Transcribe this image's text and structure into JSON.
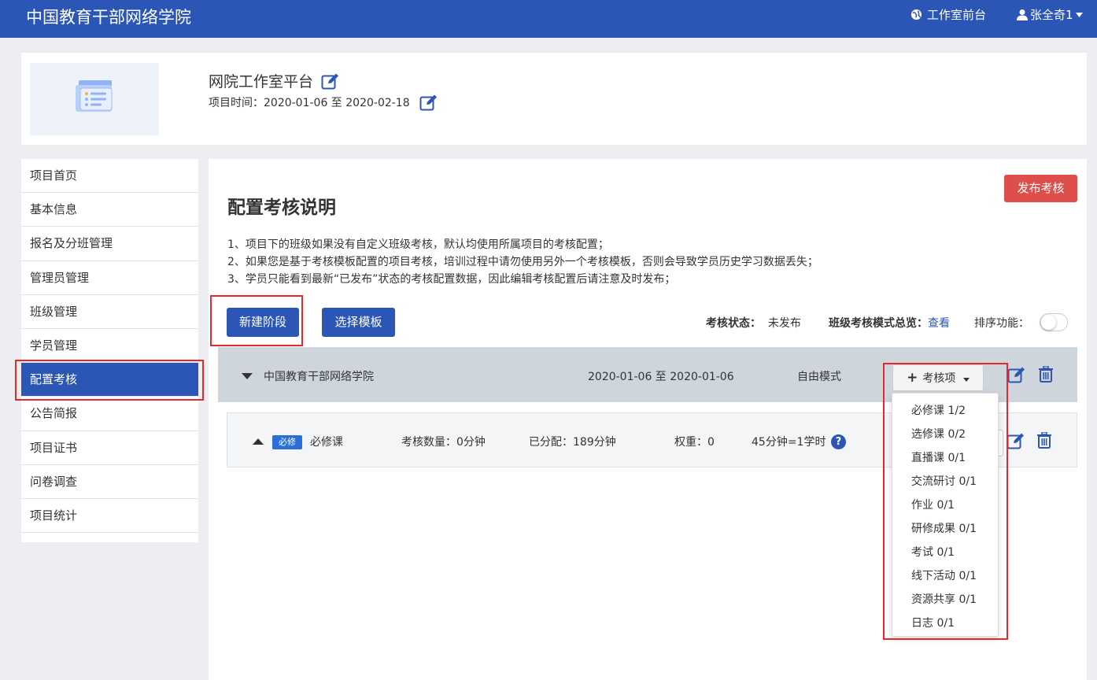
{
  "header": {
    "brand": "中国教育干部网络学院",
    "studio_link": "工作室前台",
    "user_name": "张全奇1"
  },
  "project": {
    "title": "网院工作室平台",
    "time_label": "项目时间：",
    "time_range": "2020-01-06 至 2020-02-18"
  },
  "sidebar": {
    "items": [
      {
        "label": "项目首页"
      },
      {
        "label": "基本信息"
      },
      {
        "label": "报名及分班管理"
      },
      {
        "label": "管理员管理"
      },
      {
        "label": "班级管理"
      },
      {
        "label": "学员管理"
      },
      {
        "label": "配置考核",
        "active": true
      },
      {
        "label": "公告简报"
      },
      {
        "label": "项目证书"
      },
      {
        "label": "问卷调查"
      },
      {
        "label": "项目统计"
      }
    ]
  },
  "main": {
    "title": "配置考核说明",
    "publish_label": "发布考核",
    "notes": [
      "1、项目下的班级如果没有自定义班级考核，默认均使用所属项目的考核配置；",
      "2、如果您是基于考核模板配置的项目考核，培训过程中请勿使用另外一个考核模板，否则会导致学员历史学习数据丢失；",
      "3、学员只能看到最新“已发布”状态的考核配置数据，因此编辑考核配置后请注意及时发布；"
    ],
    "new_stage_label": "新建阶段",
    "select_template_label": "选择模板",
    "status_label": "考核状态：",
    "status_value": "未发布",
    "overview_label": "班级考核模式总览：",
    "overview_link": "查看",
    "sort_label": "排序功能："
  },
  "stage": {
    "name": "中国教育干部网络学院",
    "date_range": "2020-01-06 至 2020-01-06",
    "mode": "自由模式",
    "add_item_label": "考核项"
  },
  "course": {
    "tag": "必修",
    "name": "必修课",
    "count_text": "考核数量：0分钟",
    "assigned_text": "已分配：189分钟",
    "weight_text": "权重：0",
    "rule_text": "45分钟=1学时"
  },
  "dropdown": {
    "items": [
      "必修课 1/2",
      "选修课 0/2",
      "直播课 0/1",
      "交流研讨 0/1",
      "作业 0/1",
      "研修成果 0/1",
      "考试 0/1",
      "线下活动 0/1",
      "资源共享 0/1",
      "日志 0/1"
    ]
  },
  "colors": {
    "primary": "#2b56b6",
    "danger": "#de4f4b",
    "highlight_box": "#e8262b"
  }
}
